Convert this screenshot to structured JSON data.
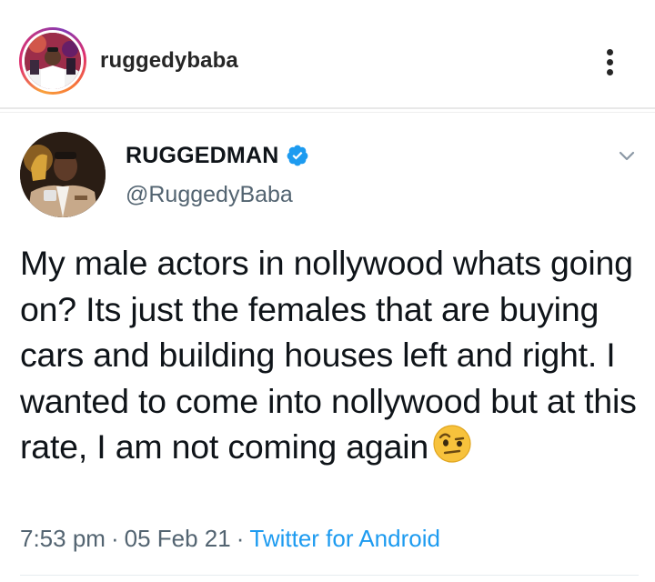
{
  "instagram": {
    "username": "ruggedybaba",
    "more_icon": "more-vertical-icon"
  },
  "tweet": {
    "display_name": "RUGGEDMAN",
    "verified_icon": "verified-badge-icon",
    "handle": "@RuggedyBaba",
    "caret_icon": "chevron-down-icon",
    "text": "My male actors in nollywood whats going on? Its just the females that are buying cars and building houses left and right. I wanted to come into nollywood but at this rate, I am not coming again",
    "emoji_icon": "face-with-raised-eyebrow-emoji",
    "time": "7:53 pm",
    "separator": "·",
    "date": "05 Feb 21",
    "source": "Twitter for Android"
  },
  "colors": {
    "text_primary": "#0f1419",
    "text_secondary": "#536471",
    "link_blue": "#1d9bf0",
    "verified_blue": "#1d9bf0"
  }
}
